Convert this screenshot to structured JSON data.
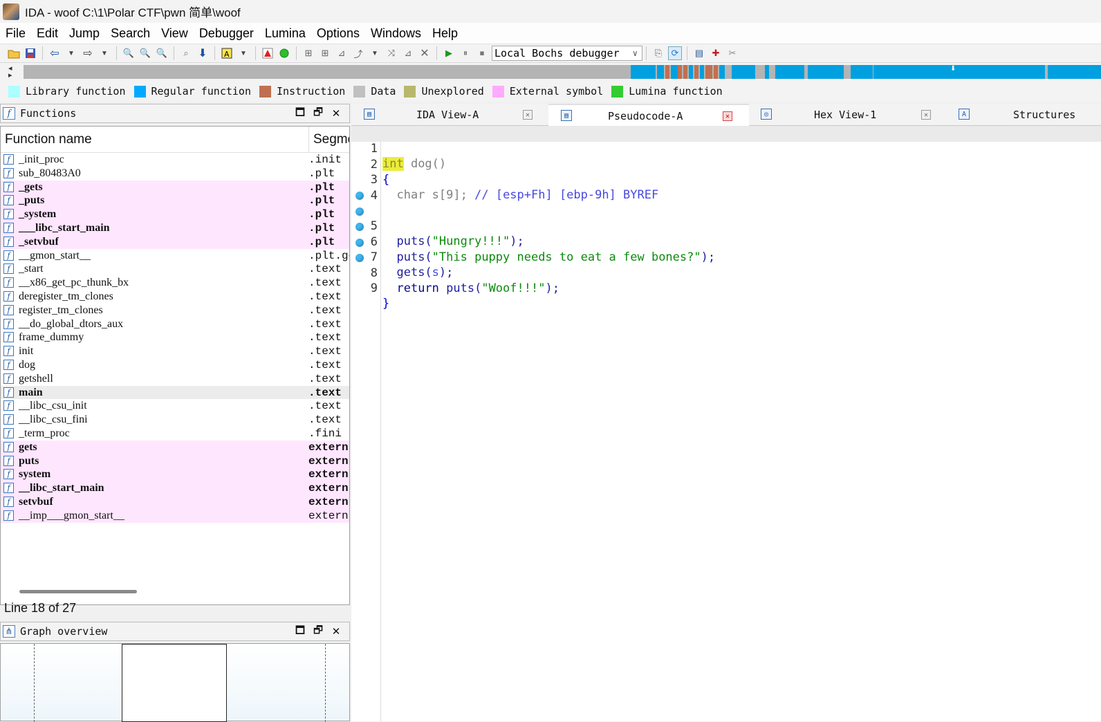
{
  "window": {
    "title": "IDA - woof C:\\1\\Polar CTF\\pwn 简单\\woof"
  },
  "menu": [
    "File",
    "Edit",
    "Jump",
    "Search",
    "View",
    "Debugger",
    "Lumina",
    "Options",
    "Windows",
    "Help"
  ],
  "toolbar": {
    "debugger_select": "Local Bochs debugger"
  },
  "legend": [
    {
      "label": "Library function",
      "color": "#aaffff"
    },
    {
      "label": "Regular function",
      "color": "#00aaff"
    },
    {
      "label": "Instruction",
      "color": "#c07050"
    },
    {
      "label": "Data",
      "color": "#c0c0c0"
    },
    {
      "label": "Unexplored",
      "color": "#b8b86c"
    },
    {
      "label": "External symbol",
      "color": "#ffaaff"
    },
    {
      "label": "Lumina function",
      "color": "#33cc33"
    }
  ],
  "functions_panel": {
    "title": "Functions",
    "col_name": "Function name",
    "col_segment": "Segme",
    "status": "Line 18 of 27",
    "rows": [
      {
        "name": "_init_proc",
        "segment": ".init"
      },
      {
        "name": "sub_80483A0",
        "segment": ".plt"
      },
      {
        "name": "_gets",
        "segment": ".plt"
      },
      {
        "name": "_puts",
        "segment": ".plt"
      },
      {
        "name": "_system",
        "segment": ".plt"
      },
      {
        "name": "___libc_start_main",
        "segment": ".plt"
      },
      {
        "name": "_setvbuf",
        "segment": ".plt"
      },
      {
        "name": "__gmon_start__",
        "segment": ".plt.go"
      },
      {
        "name": "_start",
        "segment": ".text"
      },
      {
        "name": "__x86_get_pc_thunk_bx",
        "segment": ".text"
      },
      {
        "name": "deregister_tm_clones",
        "segment": ".text"
      },
      {
        "name": "register_tm_clones",
        "segment": ".text"
      },
      {
        "name": "__do_global_dtors_aux",
        "segment": ".text"
      },
      {
        "name": "frame_dummy",
        "segment": ".text"
      },
      {
        "name": "init",
        "segment": ".text"
      },
      {
        "name": "dog",
        "segment": ".text"
      },
      {
        "name": "getshell",
        "segment": ".text"
      },
      {
        "name": "main",
        "segment": ".text"
      },
      {
        "name": "__libc_csu_init",
        "segment": ".text"
      },
      {
        "name": "__libc_csu_fini",
        "segment": ".text"
      },
      {
        "name": "_term_proc",
        "segment": ".fini"
      },
      {
        "name": "gets",
        "segment": "extern"
      },
      {
        "name": "puts",
        "segment": "extern"
      },
      {
        "name": "system",
        "segment": "extern"
      },
      {
        "name": "__libc_start_main",
        "segment": "extern"
      },
      {
        "name": "setvbuf",
        "segment": "extern"
      },
      {
        "name": "__imp___gmon_start__",
        "segment": "extern"
      }
    ]
  },
  "graph_panel": {
    "title": "Graph overview"
  },
  "tabs": [
    {
      "label": "IDA View-A"
    },
    {
      "label": "Pseudocode-A"
    },
    {
      "label": "Hex View-1"
    },
    {
      "label": "Structures"
    }
  ],
  "code": {
    "line_numbers": [
      "1",
      "2",
      "3",
      "4",
      "5",
      "6",
      "7",
      "8",
      "9"
    ],
    "l1_type": "int",
    "l1_rest": " dog()",
    "l2": "{",
    "l3_kw": "char ",
    "l3_var": "s",
    "l3_dim": "[9]",
    "l3_semi": "; ",
    "l3_comment": "// [esp+Fh] [ebp-9h] BYREF",
    "l5_fn": "puts(",
    "l5_str": "\"Hungry!!!\"",
    "l5_end": ");",
    "l6_fn": "puts(",
    "l6_str": "\"This puppy needs to eat a few bones?\"",
    "l6_end": ");",
    "l7_fn": "gets(",
    "l7_var": "s",
    "l7_end": ");",
    "l8_kw": "return ",
    "l8_fn": "puts(",
    "l8_str": "\"Woof!!!\"",
    "l8_end": ");",
    "l9": "}"
  }
}
